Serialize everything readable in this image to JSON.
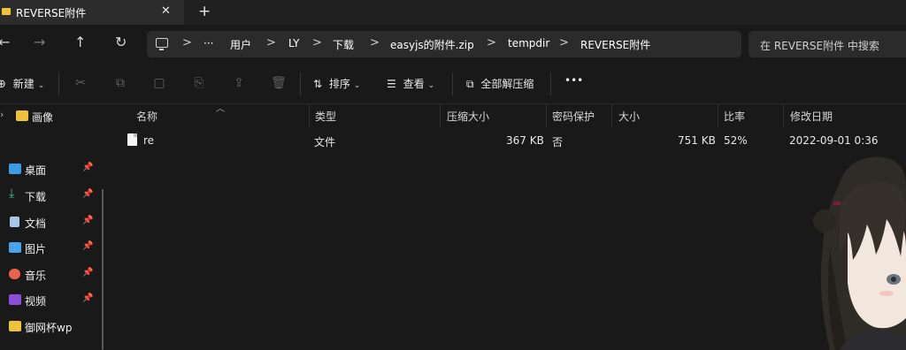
{
  "window": {
    "tab_title": "REVERSE附件",
    "tab_close": "✕",
    "new_tab": "+"
  },
  "nav": {
    "back": "←",
    "forward": "→",
    "up": "↑",
    "refresh": "↻",
    "more": "···",
    "breadcrumbs": [
      "用户",
      "LY",
      "下载",
      "easyjs的附件.zip",
      "tempdir",
      "REVERSE附件"
    ],
    "separator": ">"
  },
  "search": {
    "placeholder": "在 REVERSE附件 中搜索"
  },
  "toolbar": {
    "new_label": "新建",
    "sort_label": "排序",
    "view_label": "查看",
    "extract_label": "全部解压缩",
    "more": "•••"
  },
  "sidebar": {
    "items": [
      {
        "label": "画像",
        "icon": "folder-icon",
        "pinned": false
      },
      {
        "label": "桌面",
        "icon": "desktop-icon",
        "pinned": true
      },
      {
        "label": "下载",
        "icon": "download-icon",
        "pinned": true
      },
      {
        "label": "文档",
        "icon": "document-icon",
        "pinned": true
      },
      {
        "label": "图片",
        "icon": "picture-icon",
        "pinned": true
      },
      {
        "label": "音乐",
        "icon": "music-icon",
        "pinned": true
      },
      {
        "label": "视频",
        "icon": "video-icon",
        "pinned": true
      },
      {
        "label": "御网杯wp",
        "icon": "folder-icon",
        "pinned": false
      }
    ]
  },
  "table": {
    "columns": [
      "名称",
      "类型",
      "压缩大小",
      "密码保护",
      "大小",
      "比率",
      "修改日期"
    ],
    "rows": [
      {
        "name": "re",
        "type": "文件",
        "compressed": "367 KB",
        "password": "否",
        "size": "751 KB",
        "ratio": "52%",
        "modified": "2022-09-01 0:36"
      }
    ]
  },
  "colors": {
    "background": "#191919",
    "folder": "#f0c23a",
    "accent": "#4cc2ff"
  }
}
